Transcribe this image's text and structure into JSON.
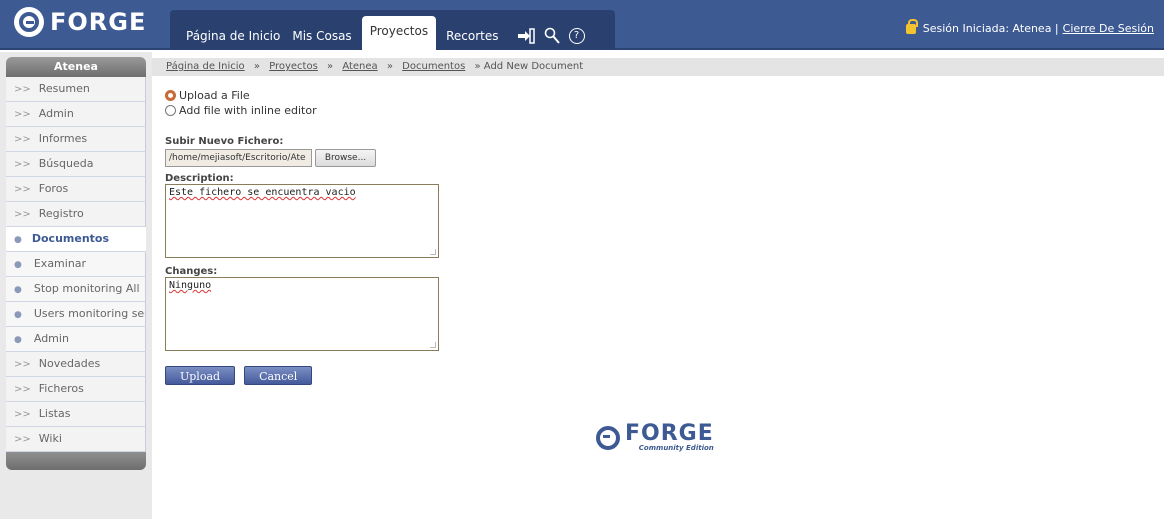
{
  "header": {
    "logo_text": "FORGE",
    "tabs": [
      {
        "label": "Página de Inicio",
        "active": false
      },
      {
        "label": "Mis Cosas",
        "active": false
      },
      {
        "label": "Proyectos",
        "active": true
      },
      {
        "label": "Recortes",
        "active": false
      }
    ],
    "icons": [
      "login-arrow-icon",
      "search-user-icon",
      "help-icon"
    ],
    "session_text": "Sesión Iniciada: Atenea |",
    "logout_link": "Cierre De Sesión"
  },
  "sidebar": {
    "title": "Atenea",
    "items_top": [
      "Resumen",
      "Admin",
      "Informes",
      "Búsqueda",
      "Foros",
      "Registro"
    ],
    "section": "Documentos",
    "sub_items": [
      "Examinar",
      "Stop monitoring All",
      "Users monitoring sect",
      "Admin"
    ],
    "items_bottom": [
      "Novedades",
      "Ficheros",
      "Listas",
      "Wiki"
    ]
  },
  "breadcrumb": {
    "links": [
      "Página de Inicio",
      "Proyectos",
      "Atenea",
      "Documentos"
    ],
    "current": "» Add New Document",
    "separator": "»"
  },
  "form": {
    "radio_upload": "Upload a File",
    "radio_inline": "Add file with inline editor",
    "upload_label": "Subir Nuevo Fichero:",
    "file_value": "/home/mejiasoft/Escritorio/Ate",
    "browse_label": "Browse...",
    "description_label": "Description:",
    "description_value": "Este fichero se encuentra vacio",
    "changes_label": "Changes:",
    "changes_value": "Ninguno",
    "upload_button": "Upload",
    "cancel_button": "Cancel"
  },
  "footer": {
    "logo_text": "FORGE",
    "edition": "Community Edition"
  },
  "colors": {
    "header_bg": "#3d5a93",
    "accent": "#c86a35",
    "button": "#5a6fae"
  }
}
